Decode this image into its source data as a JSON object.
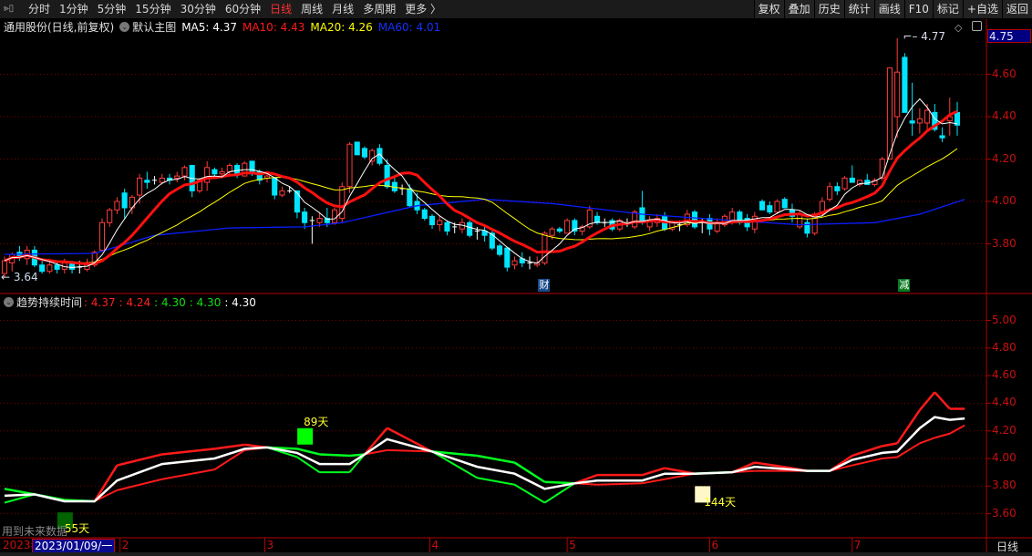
{
  "toolbar": {
    "periods": [
      "分时",
      "1分钟",
      "5分钟",
      "15分钟",
      "30分钟",
      "60分钟",
      "日线",
      "周线",
      "月线",
      "多周期",
      "更多 〉"
    ],
    "active_period": "日线",
    "buttons": [
      "复权",
      "叠加",
      "历史",
      "统计",
      "画线",
      "F10",
      "标记",
      "+自选",
      "返回"
    ]
  },
  "main_header": {
    "title": "通用股份(日线,前复权)",
    "template": "默认主图",
    "ma5": "MA5: 4.37",
    "ma10": "MA10: 4.43",
    "ma20": "MA20: 4.26",
    "ma60": "MA60: 4.01"
  },
  "sub_header": {
    "title": "趋势持续时间",
    "values": [
      ": 4.37",
      ": 4.24",
      ": 4.30",
      ": 4.30",
      ": 4.30"
    ]
  },
  "current_price": "4.75",
  "colors": {
    "up": "#ff3c3c",
    "down": "#00e5ff",
    "ma5": "#ffffff",
    "ma10": "#ff1010",
    "ma20": "#ffff00",
    "ma60": "#0a1eff",
    "grid": "#7a0000",
    "axis": "#c81010",
    "trend_up": "#ff1a1a",
    "trend_down": "#00ff20",
    "mid": "#ffffff"
  },
  "date_bar": {
    "year": "2023年",
    "selected": "2023/01/09/一",
    "period_label": "日线"
  },
  "overlay_text": {
    "future_data": "用到未来数据"
  },
  "chart_data": [
    {
      "type": "candlestick",
      "title": "通用股份(日线,前复权)",
      "ylim": [
        3.6,
        4.8
      ],
      "yticks": [
        "3.80",
        "4.00",
        "4.20",
        "4.40",
        "4.60"
      ],
      "grid": true,
      "first_date": "2023/01/09",
      "month_ticks": [
        {
          "label": "2",
          "idx": 15.4
        },
        {
          "label": "3",
          "idx": 34.7
        },
        {
          "label": "4",
          "idx": 56.7
        },
        {
          "label": "5",
          "idx": 75
        },
        {
          "label": "6",
          "idx": 94
        },
        {
          "label": "7",
          "idx": 113
        }
      ],
      "ohlc": [
        [
          3.66,
          3.74,
          3.64,
          3.72
        ],
        [
          3.71,
          3.76,
          3.67,
          3.75
        ],
        [
          3.76,
          3.79,
          3.72,
          3.74
        ],
        [
          3.73,
          3.79,
          3.7,
          3.77
        ],
        [
          3.77,
          3.79,
          3.69,
          3.7
        ],
        [
          3.7,
          3.72,
          3.66,
          3.67
        ],
        [
          3.67,
          3.72,
          3.66,
          3.7
        ],
        [
          3.7,
          3.71,
          3.66,
          3.68
        ],
        [
          3.68,
          3.73,
          3.66,
          3.71
        ],
        [
          3.71,
          3.72,
          3.66,
          3.68
        ],
        [
          3.69,
          3.72,
          3.66,
          3.69
        ],
        [
          3.68,
          3.73,
          3.67,
          3.71
        ],
        [
          3.7,
          3.77,
          3.69,
          3.76
        ],
        [
          3.77,
          3.92,
          3.76,
          3.9
        ],
        [
          3.9,
          3.97,
          3.88,
          3.96
        ],
        [
          3.96,
          4.02,
          3.94,
          4.0
        ],
        [
          4.04,
          4.06,
          3.92,
          3.97
        ],
        [
          3.97,
          4.03,
          3.94,
          4.02
        ],
        [
          4.03,
          4.13,
          3.99,
          4.11
        ],
        [
          4.1,
          4.14,
          4.06,
          4.09
        ],
        [
          4.1,
          4.12,
          4.08,
          4.1
        ],
        [
          4.09,
          4.13,
          4.08,
          4.11
        ],
        [
          4.11,
          4.13,
          4.08,
          4.1
        ],
        [
          4.11,
          4.14,
          4.09,
          4.12
        ],
        [
          4.12,
          4.17,
          4.1,
          4.16
        ],
        [
          4.17,
          4.17,
          4.02,
          4.05
        ],
        [
          4.05,
          4.11,
          4.04,
          4.1
        ],
        [
          4.09,
          4.19,
          4.05,
          4.16
        ],
        [
          4.15,
          4.16,
          4.11,
          4.13
        ],
        [
          4.13,
          4.16,
          4.11,
          4.14
        ],
        [
          4.14,
          4.18,
          4.13,
          4.17
        ],
        [
          4.17,
          4.18,
          4.11,
          4.13
        ],
        [
          4.12,
          4.19,
          4.12,
          4.18
        ],
        [
          4.19,
          4.19,
          4.12,
          4.13
        ],
        [
          4.14,
          4.15,
          4.08,
          4.1
        ],
        [
          4.11,
          4.13,
          4.09,
          4.12
        ],
        [
          4.11,
          4.11,
          4.01,
          4.03
        ],
        [
          4.03,
          4.07,
          4.02,
          4.05
        ],
        [
          4.05,
          4.07,
          4.04,
          4.05
        ],
        [
          4.05,
          4.05,
          3.92,
          3.95
        ],
        [
          3.95,
          3.97,
          3.87,
          3.9
        ],
        [
          3.91,
          3.93,
          3.8,
          3.91
        ],
        [
          3.9,
          3.95,
          3.88,
          3.92
        ],
        [
          3.92,
          3.97,
          3.88,
          3.9
        ],
        [
          3.9,
          3.97,
          3.89,
          3.96
        ],
        [
          3.92,
          4.09,
          3.9,
          4.07
        ],
        [
          4.07,
          4.28,
          4.04,
          4.27
        ],
        [
          4.28,
          4.28,
          4.22,
          4.22
        ],
        [
          4.25,
          4.26,
          4.2,
          4.21
        ],
        [
          4.19,
          4.25,
          4.17,
          4.24
        ],
        [
          4.25,
          4.27,
          4.17,
          4.18
        ],
        [
          4.17,
          4.2,
          4.06,
          4.07
        ],
        [
          4.09,
          4.11,
          4.04,
          4.05
        ],
        [
          4.06,
          4.08,
          4.03,
          4.06
        ],
        [
          4.06,
          4.08,
          3.97,
          3.98
        ],
        [
          4.0,
          4.04,
          3.94,
          3.96
        ],
        [
          3.96,
          3.97,
          3.91,
          3.92
        ],
        [
          3.93,
          3.94,
          3.87,
          3.89
        ],
        [
          3.89,
          3.93,
          3.86,
          3.91
        ],
        [
          3.9,
          3.91,
          3.84,
          3.86
        ],
        [
          3.88,
          3.9,
          3.85,
          3.88
        ],
        [
          3.87,
          3.92,
          3.85,
          3.9
        ],
        [
          3.9,
          3.91,
          3.83,
          3.84
        ],
        [
          3.86,
          3.88,
          3.82,
          3.86
        ],
        [
          3.86,
          3.89,
          3.81,
          3.84
        ],
        [
          3.85,
          3.86,
          3.77,
          3.78
        ],
        [
          3.79,
          3.8,
          3.74,
          3.75
        ],
        [
          3.78,
          3.78,
          3.67,
          3.69
        ],
        [
          3.7,
          3.74,
          3.68,
          3.72
        ],
        [
          3.73,
          3.76,
          3.69,
          3.71
        ],
        [
          3.71,
          3.74,
          3.68,
          3.71
        ],
        [
          3.7,
          3.74,
          3.69,
          3.71
        ],
        [
          3.71,
          3.86,
          3.7,
          3.85
        ],
        [
          3.84,
          3.88,
          3.82,
          3.87
        ],
        [
          3.87,
          3.88,
          3.85,
          3.86
        ],
        [
          3.85,
          3.92,
          3.85,
          3.91
        ],
        [
          3.91,
          3.92,
          3.84,
          3.86
        ],
        [
          3.86,
          3.89,
          3.84,
          3.88
        ],
        [
          3.88,
          3.98,
          3.87,
          3.96
        ],
        [
          3.93,
          3.95,
          3.89,
          3.9
        ],
        [
          3.9,
          3.92,
          3.88,
          3.9
        ],
        [
          3.91,
          3.92,
          3.86,
          3.87
        ],
        [
          3.87,
          3.92,
          3.86,
          3.91
        ],
        [
          3.9,
          3.92,
          3.88,
          3.9
        ],
        [
          3.88,
          3.96,
          3.87,
          3.95
        ],
        [
          3.97,
          4.05,
          3.89,
          3.9
        ],
        [
          3.88,
          3.93,
          3.86,
          3.91
        ],
        [
          3.9,
          3.94,
          3.88,
          3.92
        ],
        [
          3.93,
          3.95,
          3.86,
          3.87
        ],
        [
          3.87,
          3.91,
          3.86,
          3.9
        ],
        [
          3.89,
          3.91,
          3.86,
          3.89
        ],
        [
          3.89,
          3.96,
          3.88,
          3.94
        ],
        [
          3.95,
          3.96,
          3.87,
          3.88
        ],
        [
          3.9,
          3.92,
          3.85,
          3.9
        ],
        [
          3.92,
          3.94,
          3.84,
          3.87
        ],
        [
          3.86,
          3.92,
          3.85,
          3.9
        ],
        [
          3.89,
          3.94,
          3.88,
          3.93
        ],
        [
          3.9,
          3.97,
          3.89,
          3.95
        ],
        [
          3.95,
          3.96,
          3.89,
          3.9
        ],
        [
          3.92,
          3.94,
          3.86,
          3.88
        ],
        [
          3.87,
          3.95,
          3.85,
          3.93
        ],
        [
          4.0,
          4.01,
          3.96,
          3.96
        ],
        [
          3.98,
          4.0,
          3.94,
          3.95
        ],
        [
          3.95,
          4.01,
          3.94,
          4.0
        ],
        [
          4.01,
          4.02,
          3.97,
          3.97
        ],
        [
          3.96,
          3.99,
          3.9,
          3.93
        ],
        [
          3.88,
          3.96,
          3.87,
          3.94
        ],
        [
          3.9,
          3.92,
          3.83,
          3.85
        ],
        [
          3.85,
          3.95,
          3.84,
          3.94
        ],
        [
          3.94,
          4.02,
          3.93,
          4.0
        ],
        [
          4.01,
          4.09,
          4.0,
          4.07
        ],
        [
          4.07,
          4.09,
          4.03,
          4.05
        ],
        [
          4.06,
          4.12,
          4.05,
          4.11
        ],
        [
          4.11,
          4.17,
          4.09,
          4.09
        ],
        [
          4.08,
          4.1,
          4.07,
          4.1
        ],
        [
          4.1,
          4.13,
          4.08,
          4.08
        ],
        [
          4.08,
          4.11,
          4.07,
          4.1
        ],
        [
          4.11,
          4.21,
          4.1,
          4.2
        ],
        [
          4.2,
          4.63,
          4.2,
          4.63
        ],
        [
          4.4,
          4.77,
          4.3,
          4.61
        ],
        [
          4.68,
          4.7,
          4.42,
          4.42
        ],
        [
          4.38,
          4.56,
          4.31,
          4.37
        ],
        [
          4.37,
          4.44,
          4.32,
          4.39
        ],
        [
          4.37,
          4.46,
          4.33,
          4.43
        ],
        [
          4.42,
          4.46,
          4.33,
          4.34
        ],
        [
          4.31,
          4.35,
          4.28,
          4.3
        ],
        [
          4.38,
          4.49,
          4.31,
          4.4
        ],
        [
          4.42,
          4.47,
          4.31,
          4.36
        ]
      ],
      "ma_periods": {
        "ma5": 5,
        "ma10": 10,
        "ma20": 20
      },
      "ma60_points": [
        [
          0,
          3.75
        ],
        [
          12,
          3.755
        ],
        [
          20,
          3.84
        ],
        [
          30,
          3.875
        ],
        [
          40,
          3.88
        ],
        [
          45,
          3.9
        ],
        [
          55,
          3.98
        ],
        [
          64,
          4.01
        ],
        [
          73,
          3.99
        ],
        [
          85,
          3.94
        ],
        [
          97,
          3.91
        ],
        [
          106,
          3.89
        ],
        [
          116,
          3.9
        ],
        [
          122,
          3.94
        ],
        [
          128,
          4.01
        ]
      ],
      "low_marker": {
        "label": "3.64",
        "idx": 0,
        "value": 3.64
      },
      "high_marker": {
        "label": "4.77",
        "idx": 120,
        "value": 4.77
      },
      "event_markers": [
        {
          "label": "财",
          "idx": 72
        },
        {
          "label": "减",
          "idx": 120
        }
      ]
    },
    {
      "type": "line",
      "title": "趋势持续时间",
      "ylim": [
        3.5,
        5.05
      ],
      "yticks": [
        "3.60",
        "3.80",
        "4.00",
        "4.20",
        "4.40",
        "4.60",
        "4.80",
        "5.00"
      ],
      "grid": true,
      "idx": [
        0,
        4,
        8,
        12,
        15,
        21,
        28,
        32,
        35,
        39,
        42,
        46,
        48,
        51,
        57,
        63,
        68,
        72,
        76,
        79,
        85,
        88,
        92,
        97,
        100,
        105,
        107,
        110,
        113,
        117,
        119,
        122,
        124,
        126,
        128
      ],
      "upper": [
        3.78,
        3.74,
        3.7,
        3.69,
        3.95,
        4.03,
        4.07,
        4.1,
        4.08,
        4.07,
        4.03,
        4.02,
        4.03,
        4.22,
        4.05,
        4.02,
        3.97,
        3.83,
        3.82,
        3.88,
        3.88,
        3.93,
        3.89,
        3.9,
        3.97,
        3.93,
        3.91,
        3.91,
        4.02,
        4.09,
        4.11,
        4.35,
        4.48,
        4.36,
        4.36
      ],
      "mid": [
        3.73,
        3.74,
        3.69,
        3.69,
        3.84,
        3.96,
        4.0,
        4.07,
        4.08,
        4.04,
        3.96,
        3.96,
        4.03,
        4.14,
        4.05,
        3.94,
        3.89,
        3.78,
        3.82,
        3.84,
        3.84,
        3.89,
        3.89,
        3.9,
        3.94,
        3.92,
        3.91,
        3.91,
        3.99,
        4.04,
        4.05,
        4.22,
        4.3,
        4.28,
        4.29
      ],
      "lower": [
        3.68,
        3.74,
        3.69,
        3.69,
        3.77,
        3.85,
        3.92,
        4.06,
        4.08,
        4.01,
        3.9,
        3.9,
        4.03,
        4.06,
        4.05,
        3.86,
        3.81,
        3.68,
        3.82,
        3.81,
        3.82,
        3.85,
        3.89,
        3.9,
        3.91,
        3.91,
        3.91,
        3.91,
        3.95,
        4.0,
        4.01,
        4.11,
        4.15,
        4.18,
        4.24
      ],
      "trend": [
        "down",
        "down",
        "down",
        "up",
        "up",
        "up",
        "up",
        "up",
        "down",
        "down",
        "down",
        "down",
        "up",
        "up",
        "down",
        "down",
        "down",
        "down",
        "up",
        "up",
        "up",
        "up",
        "down",
        "up",
        "up",
        "up",
        "down",
        "up",
        "up",
        "up",
        "up",
        "up",
        "up",
        "up",
        "up"
      ],
      "cycle_markers": [
        {
          "label": "55天",
          "idx": 8,
          "value": 3.55,
          "color": "#006400"
        },
        {
          "label": "89天",
          "idx": 40,
          "value": 4.16,
          "color": "#00ff00"
        },
        {
          "label": "144天",
          "idx": 93,
          "value": 3.74,
          "color": "#fff8c8"
        }
      ]
    }
  ]
}
